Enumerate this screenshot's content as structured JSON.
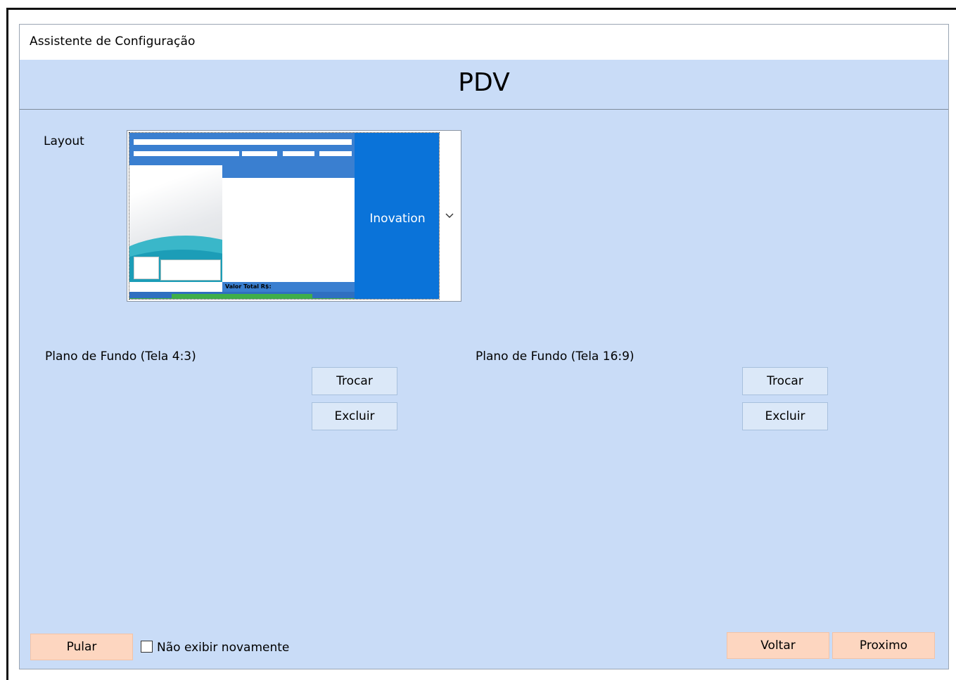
{
  "window": {
    "title": "Assistente de Configuração"
  },
  "header": {
    "title": "PDV"
  },
  "layout": {
    "label": "Layout",
    "selected_name": "Inovation",
    "preview": {
      "total_label": "Valor Total R$:"
    }
  },
  "backgrounds": {
    "left": {
      "label": "Plano de Fundo (Tela 4:3)",
      "swap_label": "Trocar",
      "delete_label": "Excluir"
    },
    "right": {
      "label": "Plano de Fundo (Tela 16:9)",
      "swap_label": "Trocar",
      "delete_label": "Excluir"
    }
  },
  "footer": {
    "skip_label": "Pular",
    "dont_show_label": "Não exibir novamente",
    "dont_show_checked": false,
    "back_label": "Voltar",
    "next_label": "Proximo"
  },
  "colors": {
    "window_bg": "#c9dcf7",
    "layout_tile": "#0a73d9",
    "secondary_button": "#dbe8f8",
    "primary_button": "#fdd6c0"
  },
  "icons": {
    "dropdown": "chevron-down-icon",
    "checkbox": "checkbox-icon"
  }
}
